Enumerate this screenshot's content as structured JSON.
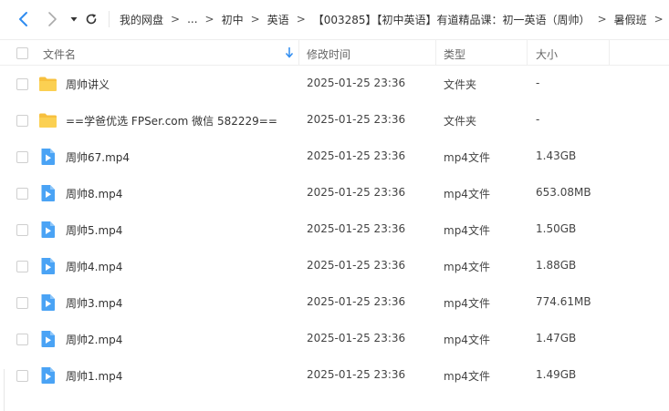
{
  "toolbar": {
    "back_icon": "chevron-left-icon",
    "forward_icon": "chevron-right-icon",
    "dropdown_icon": "caret-down-icon",
    "refresh_icon": "refresh-icon",
    "accent_color": "#2f8cf0"
  },
  "breadcrumb": {
    "items": [
      "我的网盘",
      "...",
      "初中",
      "英语",
      "【003285】【初中英语】有道精品课：初一英语（周帅）",
      "暑假班"
    ],
    "separator": ">"
  },
  "header": {
    "name": "文件名",
    "modified": "修改时间",
    "type": "类型",
    "size": "大小",
    "sort_icon": "sort-down-arrow-icon"
  },
  "files": [
    {
      "name": "周帅讲义",
      "modified": "2025-01-25 23:36",
      "type": "文件夹",
      "size": "-",
      "icon": "folder-icon"
    },
    {
      "name": "==学爸优选 FPSer.com 微信 582229==",
      "modified": "2025-01-25 23:36",
      "type": "文件夹",
      "size": "-",
      "icon": "folder-icon"
    },
    {
      "name": "周帅67.mp4",
      "modified": "2025-01-25 23:36",
      "type": "mp4文件",
      "size": "1.43GB",
      "icon": "video-file-icon"
    },
    {
      "name": "周帅8.mp4",
      "modified": "2025-01-25 23:36",
      "type": "mp4文件",
      "size": "653.08MB",
      "icon": "video-file-icon"
    },
    {
      "name": "周帅5.mp4",
      "modified": "2025-01-25 23:36",
      "type": "mp4文件",
      "size": "1.50GB",
      "icon": "video-file-icon"
    },
    {
      "name": "周帅4.mp4",
      "modified": "2025-01-25 23:36",
      "type": "mp4文件",
      "size": "1.88GB",
      "icon": "video-file-icon"
    },
    {
      "name": "周帅3.mp4",
      "modified": "2025-01-25 23:36",
      "type": "mp4文件",
      "size": "774.61MB",
      "icon": "video-file-icon"
    },
    {
      "name": "周帅2.mp4",
      "modified": "2025-01-25 23:36",
      "type": "mp4文件",
      "size": "1.47GB",
      "icon": "video-file-icon"
    },
    {
      "name": "周帅1.mp4",
      "modified": "2025-01-25 23:36",
      "type": "mp4文件",
      "size": "1.49GB",
      "icon": "video-file-icon"
    }
  ],
  "colors": {
    "folder": "#f7c03e",
    "video": "#4aa3f5",
    "text": "#333333",
    "header_text": "#666666"
  }
}
